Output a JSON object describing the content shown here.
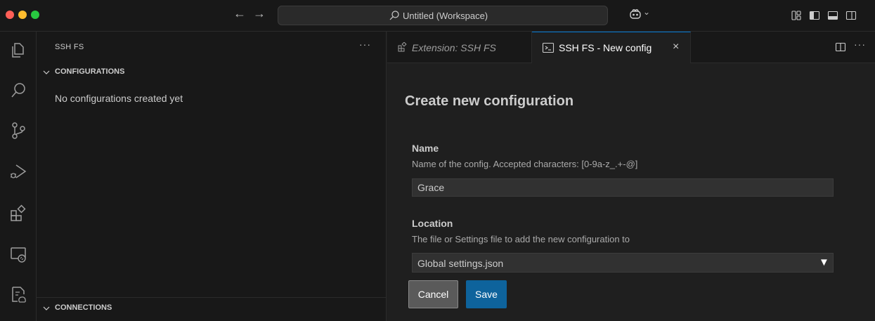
{
  "titlebar": {
    "search_text": "Untitled (Workspace)"
  },
  "sidebar": {
    "title": "SSH FS",
    "more": "···",
    "configurations_header": "CONFIGURATIONS",
    "empty_message": "No configurations created yet",
    "connections_header": "CONNECTIONS"
  },
  "tabs": {
    "tab1_label": "Extension: SSH FS",
    "tab2_label": "SSH FS - New config",
    "close": "×",
    "more": "···"
  },
  "form": {
    "title": "Create new configuration",
    "name_label": "Name",
    "name_desc": "Name of the config. Accepted characters: [0-9a-z_.+-@]",
    "name_value": "Grace",
    "location_label": "Location",
    "location_desc": "The file or Settings file to add the new configuration to",
    "location_value": "Global settings.json",
    "cancel_label": "Cancel",
    "save_label": "Save"
  },
  "colors": {
    "accent": "#0078d4",
    "save_button": "#0e639c",
    "background": "#1f1f1f",
    "sidebar": "#181818"
  },
  "icons": [
    "explorer-icon",
    "search-icon",
    "source-control-icon",
    "run-debug-icon",
    "extensions-icon",
    "remote-explorer-icon",
    "ssh-fs-icon",
    "copilot-icon",
    "layout-icon",
    "split-editor-icon"
  ]
}
